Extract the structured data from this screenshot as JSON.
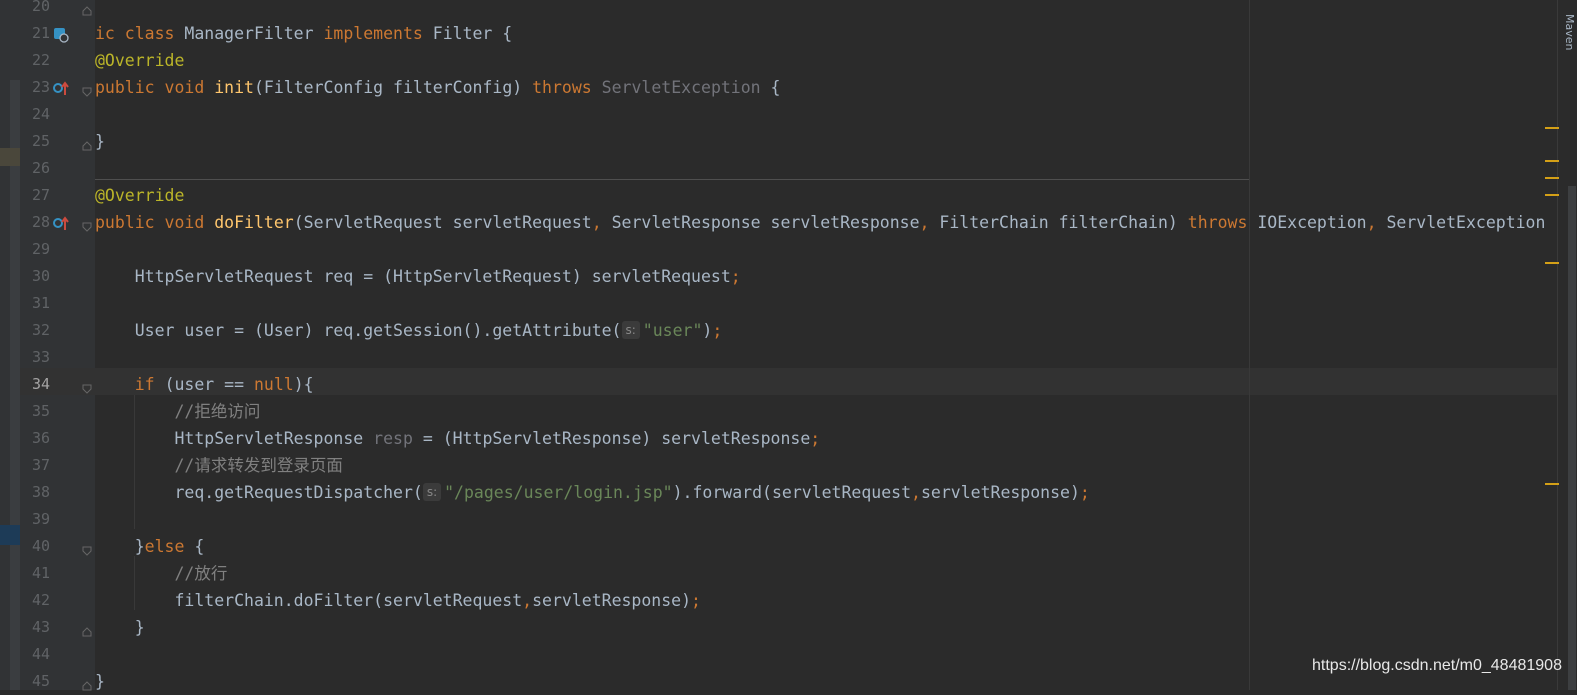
{
  "editor": {
    "lines": [
      {
        "n": "20",
        "tokens": []
      },
      {
        "n": "21",
        "tokens": [
          {
            "t": "ic class ",
            "c": "kw"
          },
          {
            "t": "ManagerFilter "
          },
          {
            "t": "implements ",
            "c": "kw"
          },
          {
            "t": "Filter {"
          }
        ]
      },
      {
        "n": "22",
        "tokens": [
          {
            "t": "@Override",
            "c": "an"
          }
        ]
      },
      {
        "n": "23",
        "tokens": [
          {
            "t": "public void ",
            "c": "kw"
          },
          {
            "t": "init",
            "c": "fn"
          },
          {
            "t": "(FilterConfig filterConfig) "
          },
          {
            "t": "throws ",
            "c": "kw"
          },
          {
            "t": "ServletException",
            "c": "unused"
          },
          {
            "t": " {"
          }
        ]
      },
      {
        "n": "24",
        "tokens": []
      },
      {
        "n": "25",
        "tokens": [
          {
            "t": "}"
          }
        ]
      },
      {
        "n": "26",
        "tokens": []
      },
      {
        "n": "27",
        "tokens": [
          {
            "t": "@Override",
            "c": "an"
          }
        ]
      },
      {
        "n": "28",
        "tokens": [
          {
            "t": "public void ",
            "c": "kw"
          },
          {
            "t": "doFilter",
            "c": "fn"
          },
          {
            "t": "(ServletRequest servletRequest"
          },
          {
            "t": ", ",
            "c": "kw"
          },
          {
            "t": "ServletResponse servletResponse"
          },
          {
            "t": ", ",
            "c": "kw"
          },
          {
            "t": "FilterChain filterChain) "
          },
          {
            "t": "throws ",
            "c": "kw"
          },
          {
            "t": "IOException"
          },
          {
            "t": ", ",
            "c": "kw"
          },
          {
            "t": "ServletException"
          }
        ]
      },
      {
        "n": "29",
        "tokens": []
      },
      {
        "n": "30",
        "tokens": [
          {
            "t": "    HttpServletRequest req = (HttpServletRequest) servletRequest"
          },
          {
            "t": ";",
            "c": "kw"
          }
        ]
      },
      {
        "n": "31",
        "tokens": []
      },
      {
        "n": "32",
        "tokens": [
          {
            "t": "    User user = (User) req.getSession().getAttribute("
          },
          {
            "hint": "s:"
          },
          {
            "t": "\"user\"",
            "c": "str"
          },
          {
            "t": ")"
          },
          {
            "t": ";",
            "c": "kw"
          }
        ]
      },
      {
        "n": "33",
        "tokens": []
      },
      {
        "n": "34",
        "tokens": [
          {
            "t": "    "
          },
          {
            "t": "if ",
            "c": "kw"
          },
          {
            "t": "(user == "
          },
          {
            "t": "null",
            "c": "kw"
          },
          {
            "t": "){"
          }
        ]
      },
      {
        "n": "35",
        "tokens": [
          {
            "t": "        //拒绝访问",
            "c": "cm"
          }
        ]
      },
      {
        "n": "36",
        "tokens": [
          {
            "t": "        HttpServletResponse "
          },
          {
            "t": "resp",
            "c": "unused"
          },
          {
            "t": " = (HttpServletResponse) servletResponse"
          },
          {
            "t": ";",
            "c": "kw"
          }
        ]
      },
      {
        "n": "37",
        "tokens": [
          {
            "t": "        //请求转发到登录页面",
            "c": "cm"
          }
        ]
      },
      {
        "n": "38",
        "tokens": [
          {
            "t": "        req.getRequestDispatcher("
          },
          {
            "hint": "s:"
          },
          {
            "t": "\"/pages/user/login.jsp\"",
            "c": "str"
          },
          {
            "t": ").forward(servletRequest"
          },
          {
            "t": ",",
            "c": "kw"
          },
          {
            "t": "servletResponse)"
          },
          {
            "t": ";",
            "c": "kw"
          }
        ]
      },
      {
        "n": "39",
        "tokens": []
      },
      {
        "n": "40",
        "tokens": [
          {
            "t": "    }"
          },
          {
            "t": "else ",
            "c": "kw"
          },
          {
            "t": "{"
          }
        ]
      },
      {
        "n": "41",
        "tokens": [
          {
            "t": "        //放行",
            "c": "cm"
          }
        ]
      },
      {
        "n": "42",
        "tokens": [
          {
            "t": "        filterChain.doFilter(servletRequest"
          },
          {
            "t": ",",
            "c": "kw"
          },
          {
            "t": "servletResponse)"
          },
          {
            "t": ";",
            "c": "kw"
          }
        ]
      },
      {
        "n": "43",
        "tokens": [
          {
            "t": "    }"
          }
        ]
      },
      {
        "n": "44",
        "tokens": []
      },
      {
        "n": "45",
        "tokens": [
          {
            "t": "}"
          }
        ]
      }
    ],
    "active_line": "34"
  },
  "right_panel": {
    "tool_window_label": "Maven"
  },
  "watermark": "https://blog.csdn.net/m0_48481908",
  "colors": {
    "keyword": "#cc7832",
    "annotation": "#bbb529",
    "method": "#ffc66d",
    "string": "#6a8759",
    "comment": "#808080",
    "text": "#a9b7c6",
    "background": "#2b2b2b",
    "gutter": "#313335",
    "marker": "#d4a017"
  },
  "icons": {
    "line_21": "class-implements-icon",
    "line_23": "override-method-icon",
    "line_28": "override-method-icon"
  }
}
